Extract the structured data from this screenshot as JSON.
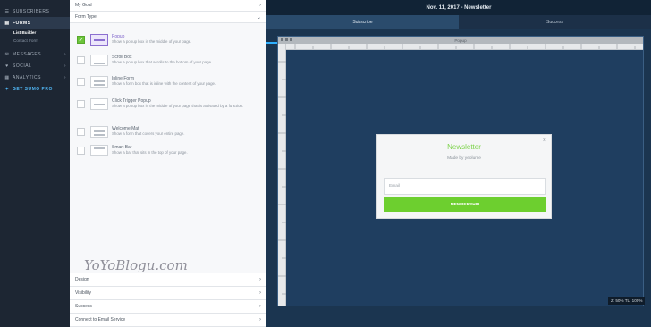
{
  "sidebar": {
    "items": [
      {
        "label": "SUBSCRIBERS",
        "icon": "subscribers-icon"
      },
      {
        "label": "FORMS",
        "icon": "forms-icon"
      },
      {
        "label": "List Builder",
        "icon": ""
      },
      {
        "label": "Contact Form",
        "icon": ""
      },
      {
        "label": "MESSAGES",
        "icon": "messages-icon"
      },
      {
        "label": "SOCIAL",
        "icon": "social-icon"
      },
      {
        "label": "ANALYTICS",
        "icon": "analytics-icon"
      },
      {
        "label": "GET SUMO PRO",
        "icon": "rocket-icon"
      }
    ],
    "active_color": "#2c3a4d",
    "pro_color": "#4fb3f0"
  },
  "panel": {
    "my_goal": "My Goal",
    "form_type": "Form Type",
    "types": [
      {
        "title": "Popup",
        "desc": "Show a popup box in the middle of your page."
      },
      {
        "title": "Scroll Box",
        "desc": "Show a popup box that scrolls to the bottom of your page."
      },
      {
        "title": "Inline Form",
        "desc": "Show a form box that is inline with the content of your page."
      },
      {
        "title": "Click Trigger Popup",
        "desc": "Show a popup box in the middle of your page that is activated by a function."
      },
      {
        "title": "Welcome Mat",
        "desc": "Show a form that covers your entire page."
      },
      {
        "title": "Smart Bar",
        "desc": "Show a bar that sits in the top of your page."
      }
    ],
    "signature": "YoYoBlogu.com",
    "sections": [
      "Design",
      "Visibility",
      "Success",
      "Connect to Email Service"
    ]
  },
  "canvas": {
    "title": "Nov. 11, 2017 - Newsletter",
    "tabs": [
      "Subscribe",
      "Success"
    ],
    "stage_label": "Popup",
    "zoom": "Z: 50%  TL: 100%",
    "accent": "#2fb0ff"
  },
  "popup": {
    "title": "Newsletter",
    "subtitle": "Made by yeolume",
    "email_placeholder": "Email",
    "button": "MEMBERSHIP",
    "close": "×",
    "brand_color": "#6dcf2f"
  }
}
